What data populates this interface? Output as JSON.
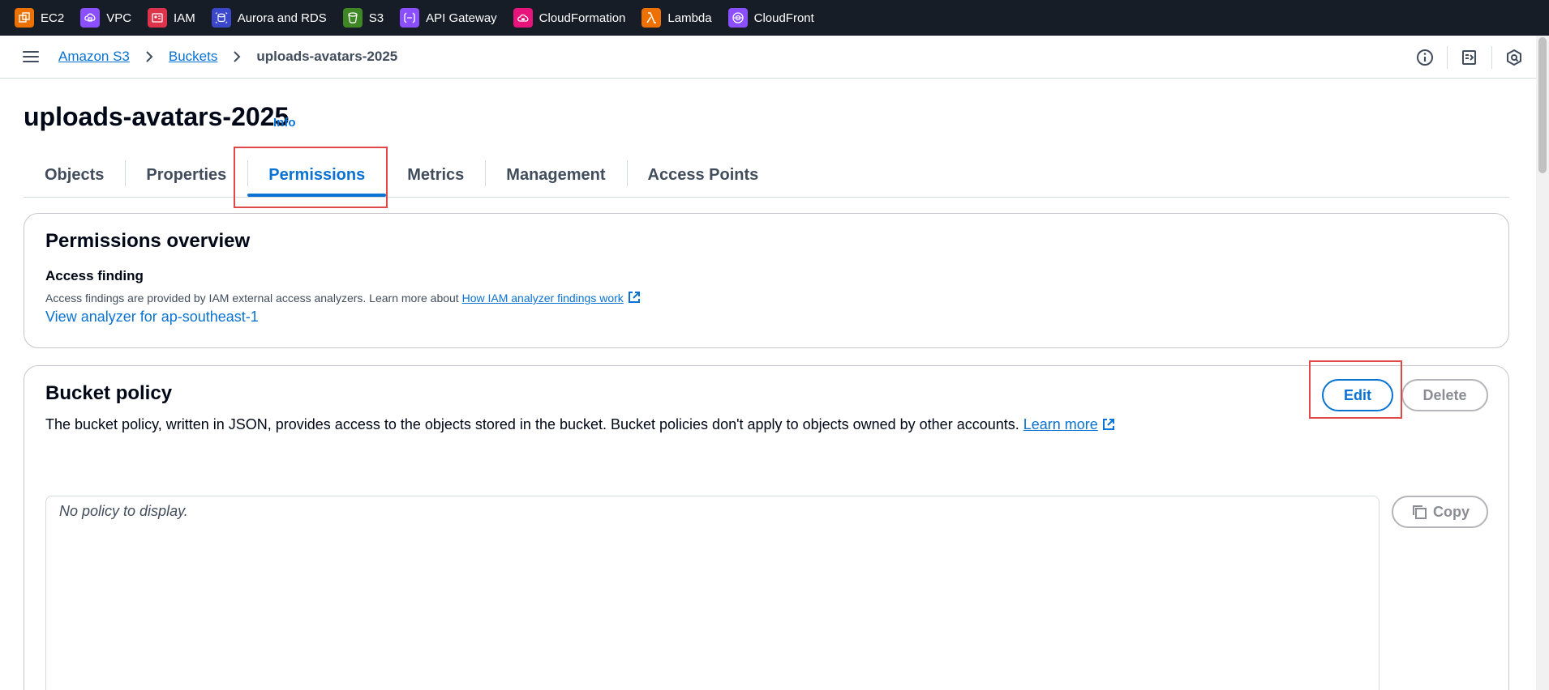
{
  "service_bar": [
    {
      "label": "EC2",
      "icon": "ec2-icon",
      "color": "#ed7100"
    },
    {
      "label": "VPC",
      "icon": "vpc-icon",
      "color": "#8c4fff"
    },
    {
      "label": "IAM",
      "icon": "iam-icon",
      "color": "#dd344c"
    },
    {
      "label": "Aurora and RDS",
      "icon": "rds-icon",
      "color": "#3b48cc"
    },
    {
      "label": "S3",
      "icon": "s3-icon",
      "color": "#3f8624"
    },
    {
      "label": "API Gateway",
      "icon": "api-gateway-icon",
      "color": "#8c4fff"
    },
    {
      "label": "CloudFormation",
      "icon": "cloudformation-icon",
      "color": "#e7157b"
    },
    {
      "label": "Lambda",
      "icon": "lambda-icon",
      "color": "#ed7100"
    },
    {
      "label": "CloudFront",
      "icon": "cloudfront-icon",
      "color": "#8c4fff"
    }
  ],
  "breadcrumb": {
    "items": [
      "Amazon S3",
      "Buckets"
    ],
    "current": "uploads-avatars-2025"
  },
  "page": {
    "title": "uploads-avatars-2025",
    "info_label": "Info"
  },
  "tabs": [
    {
      "label": "Objects",
      "active": false
    },
    {
      "label": "Properties",
      "active": false
    },
    {
      "label": "Permissions",
      "active": true
    },
    {
      "label": "Metrics",
      "active": false
    },
    {
      "label": "Management",
      "active": false
    },
    {
      "label": "Access Points",
      "active": false
    }
  ],
  "permissions_overview": {
    "heading": "Permissions overview",
    "access_finding_label": "Access finding",
    "description": "Access findings are provided by IAM external access analyzers. Learn more about ",
    "learn_link": "How IAM analyzer findings work",
    "analyzer_link": "View analyzer for ap-southeast-1"
  },
  "bucket_policy": {
    "heading": "Bucket policy",
    "description": "The bucket policy, written in JSON, provides access to the objects stored in the bucket. Bucket policies don't apply to objects owned by other accounts. ",
    "learn_more": "Learn more",
    "edit_label": "Edit",
    "delete_label": "Delete",
    "copy_label": "Copy",
    "empty_text": "No policy to display."
  },
  "colors": {
    "accent": "#0972d3",
    "highlight": "#e04848",
    "topbar": "#161d26"
  }
}
